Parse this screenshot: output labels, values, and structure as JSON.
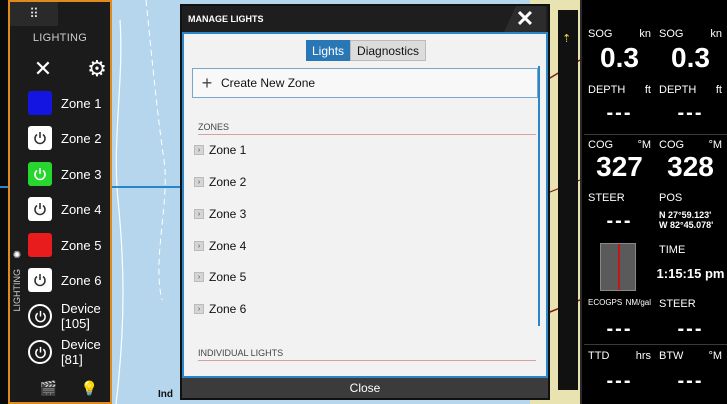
{
  "lighting_panel": {
    "title": "LIGHTING",
    "side_tab_label": "LIGHTING",
    "zones": [
      {
        "label": "Zone 1",
        "color": "#1515e0",
        "icon": "power-icon"
      },
      {
        "label": "Zone 2",
        "color": "#ffffff",
        "icon": "power-icon"
      },
      {
        "label": "Zone 3",
        "color": "#27d62e",
        "icon": "power-icon"
      },
      {
        "label": "Zone 4",
        "color": "#ffffff",
        "icon": "power-icon"
      },
      {
        "label": "Zone 5",
        "color": "#e81c1c",
        "icon": "power-icon"
      },
      {
        "label": "Zone 6",
        "color": "#ffffff",
        "icon": "power-icon"
      }
    ],
    "devices": [
      {
        "label_line1": "Device",
        "label_line2": "[105]"
      },
      {
        "label_line1": "Device",
        "label_line2": "[81]"
      }
    ],
    "accent_color": "#e08a1e"
  },
  "dialog": {
    "title": "MANAGE LIGHTS",
    "tabs": [
      {
        "label": "Lights",
        "active": true
      },
      {
        "label": "Diagnostics",
        "active": false
      }
    ],
    "create_zone_label": "Create New Zone",
    "zones_heading": "ZONES",
    "zone_items": [
      "Zone 1",
      "Zone 2",
      "Zone 3",
      "Zone 4",
      "Zone 5",
      "Zone 6"
    ],
    "individual_lights_heading": "INDIVIDUAL LIGHTS",
    "close_label": "Close",
    "accent_color": "#2a77b6"
  },
  "chart": {
    "label": "Ind"
  },
  "instruments": {
    "sog_1": {
      "label": "SOG",
      "unit": "kn",
      "value": "0.3"
    },
    "sog_2": {
      "label": "SOG",
      "unit": "kn",
      "value": "0.3"
    },
    "depth_1": {
      "label": "DEPTH",
      "unit": "ft",
      "value": "---"
    },
    "depth_2": {
      "label": "DEPTH",
      "unit": "ft",
      "value": "---"
    },
    "cog_1": {
      "label": "COG",
      "unit": "°M",
      "value": "327"
    },
    "cog_2": {
      "label": "COG",
      "unit": "°M",
      "value": "328"
    },
    "steer_1": {
      "label": "STEER",
      "value": "---"
    },
    "pos": {
      "label": "POS",
      "lat": "N  27°59.123'",
      "lon": "W  82°45.078'"
    },
    "time": {
      "label": "TIME",
      "value": "1:15:15 pm"
    },
    "ecogps": {
      "label": "ECOGPS",
      "unit": "NM/gal",
      "value": "---"
    },
    "steer_2": {
      "label": "STEER",
      "value": "---"
    },
    "ttd": {
      "label": "TTD",
      "unit": "hrs",
      "value": "---"
    },
    "btw": {
      "label": "BTW",
      "unit": "°M",
      "value": "---"
    }
  }
}
